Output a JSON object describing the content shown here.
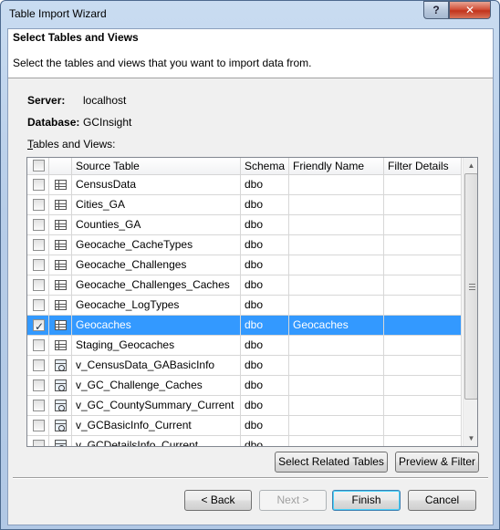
{
  "window": {
    "title": "Table Import Wizard",
    "help_label": "?",
    "close_label": "✕"
  },
  "header": {
    "title": "Select Tables and Views",
    "description": "Select the tables and views that you want to import data from."
  },
  "info": {
    "server_label": "Server:",
    "server_value": "localhost",
    "database_label": "Database:",
    "database_value": "GCInsight",
    "tables_label_prefix": "T",
    "tables_label_rest": "ables and Views:"
  },
  "grid": {
    "columns": [
      "",
      "",
      "Source Table",
      "Schema",
      "Friendly Name",
      "Filter Details"
    ],
    "rows": [
      {
        "checked": false,
        "icon": "table-icon",
        "source": "CensusData",
        "schema": "dbo",
        "friendly": "",
        "filter": "",
        "selected": false
      },
      {
        "checked": false,
        "icon": "table-icon",
        "source": "Cities_GA",
        "schema": "dbo",
        "friendly": "",
        "filter": "",
        "selected": false
      },
      {
        "checked": false,
        "icon": "table-icon",
        "source": "Counties_GA",
        "schema": "dbo",
        "friendly": "",
        "filter": "",
        "selected": false
      },
      {
        "checked": false,
        "icon": "table-icon",
        "source": "Geocache_CacheTypes",
        "schema": "dbo",
        "friendly": "",
        "filter": "",
        "selected": false
      },
      {
        "checked": false,
        "icon": "table-icon",
        "source": "Geocache_Challenges",
        "schema": "dbo",
        "friendly": "",
        "filter": "",
        "selected": false
      },
      {
        "checked": false,
        "icon": "table-icon",
        "source": "Geocache_Challenges_Caches",
        "schema": "dbo",
        "friendly": "",
        "filter": "",
        "selected": false
      },
      {
        "checked": false,
        "icon": "table-icon",
        "source": "Geocache_LogTypes",
        "schema": "dbo",
        "friendly": "",
        "filter": "",
        "selected": false
      },
      {
        "checked": true,
        "icon": "table-icon",
        "source": "Geocaches",
        "schema": "dbo",
        "friendly": "Geocaches",
        "filter": "",
        "selected": true
      },
      {
        "checked": false,
        "icon": "table-icon",
        "source": "Staging_Geocaches",
        "schema": "dbo",
        "friendly": "",
        "filter": "",
        "selected": false
      },
      {
        "checked": false,
        "icon": "view-icon",
        "source": "v_CensusData_GABasicInfo",
        "schema": "dbo",
        "friendly": "",
        "filter": "",
        "selected": false
      },
      {
        "checked": false,
        "icon": "view-icon",
        "source": "v_GC_Challenge_Caches",
        "schema": "dbo",
        "friendly": "",
        "filter": "",
        "selected": false
      },
      {
        "checked": false,
        "icon": "view-icon",
        "source": "v_GC_CountySummary_Current",
        "schema": "dbo",
        "friendly": "",
        "filter": "",
        "selected": false
      },
      {
        "checked": false,
        "icon": "view-icon",
        "source": "v_GCBasicInfo_Current",
        "schema": "dbo",
        "friendly": "",
        "filter": "",
        "selected": false
      },
      {
        "checked": false,
        "icon": "view-icon",
        "source": "v_GCDetailsInfo_Current",
        "schema": "dbo",
        "friendly": "",
        "filter": "",
        "selected": false
      }
    ]
  },
  "actions": {
    "select_related": "Select Related Tables",
    "preview_filter": "Preview & Filter"
  },
  "footer": {
    "back": "< Back",
    "next": "Next >",
    "finish": "Finish",
    "cancel": "Cancel"
  }
}
